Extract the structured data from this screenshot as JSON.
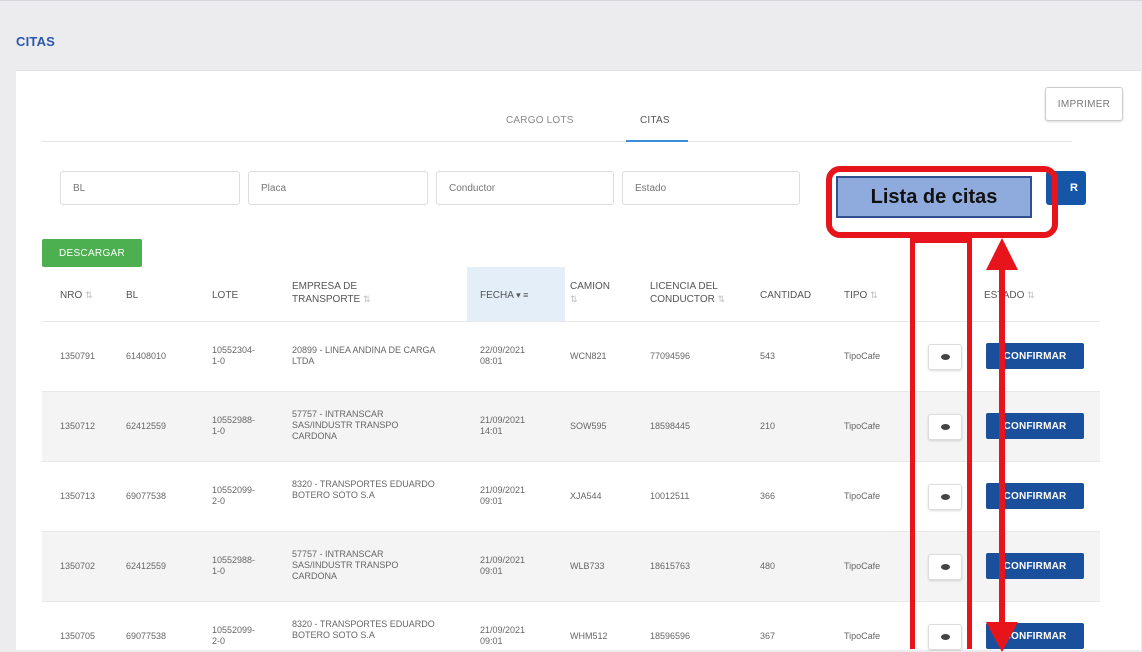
{
  "page": {
    "title": "CITAS"
  },
  "toolbar": {
    "print_label": "IMPRIMER"
  },
  "tabs": [
    {
      "label": "CARGO LOTS"
    },
    {
      "label": "CITAS"
    }
  ],
  "filters": {
    "bl": {
      "placeholder": "BL"
    },
    "placa": {
      "placeholder": "Placa"
    },
    "conductor": {
      "placeholder": "Conductor"
    },
    "estado": {
      "placeholder": "Estado"
    },
    "search_label": "R"
  },
  "download_label": "DESCARGAR",
  "table": {
    "headers": {
      "nro": "NRO",
      "bl": "BL",
      "lote": "LOTE",
      "empresa": "EMPRESA DE TRANSPORTE",
      "fecha": "FECHA",
      "camion": "CAMION",
      "licencia": "LICENCIA DEL CONDUCTOR",
      "cantidad": "CANTIDAD",
      "tipo": "TIPO",
      "estado": "ESTADO"
    },
    "rows": [
      {
        "nro": "1350791",
        "bl": "61408010",
        "lote": "10552304-1-0",
        "empresa": "20899 - LINEA ANDINA DE CARGA LTDA",
        "fecha": "22/09/2021 08:01",
        "camion": "WCN821",
        "licencia": "77094596",
        "cantidad": "543",
        "tipo": "TipoCafe",
        "action": "CONFIRMAR"
      },
      {
        "nro": "1350712",
        "bl": "62412559",
        "lote": "10552988-1-0",
        "empresa": "57757 - INTRANSCAR SAS/INDUSTR TRANSPO CARDONA",
        "fecha": "21/09/2021 14:01",
        "camion": "SOW595",
        "licencia": "18598445",
        "cantidad": "210",
        "tipo": "TipoCafe",
        "action": "CONFIRMAR"
      },
      {
        "nro": "1350713",
        "bl": "69077538",
        "lote": "10552099-2-0",
        "empresa": "8320 - TRANSPORTES EDUARDO BOTERO SOTO S.A",
        "fecha": "21/09/2021 09:01",
        "camion": "XJA544",
        "licencia": "10012511",
        "cantidad": "366",
        "tipo": "TipoCafe",
        "action": "CONFIRMAR"
      },
      {
        "nro": "1350702",
        "bl": "62412559",
        "lote": "10552988-1-0",
        "empresa": "57757 - INTRANSCAR SAS/INDUSTR TRANSPO CARDONA",
        "fecha": "21/09/2021 09:01",
        "camion": "WLB733",
        "licencia": "18615763",
        "cantidad": "480",
        "tipo": "TipoCafe",
        "action": "CONFIRMAR"
      },
      {
        "nro": "1350705",
        "bl": "69077538",
        "lote": "10552099-2-0",
        "empresa": "8320 - TRANSPORTES EDUARDO BOTERO SOTO S.A",
        "fecha": "21/09/2021 09:01",
        "camion": "WHM512",
        "licencia": "18596596",
        "cantidad": "367",
        "tipo": "TipoCafe",
        "action": "CONFIRMAR"
      }
    ]
  },
  "annotation": {
    "label": "Lista de citas"
  },
  "colors": {
    "accent": "#1a4f9c",
    "download": "#4caf50",
    "highlight": "#e8141b",
    "callout_fill": "#8faadc"
  }
}
